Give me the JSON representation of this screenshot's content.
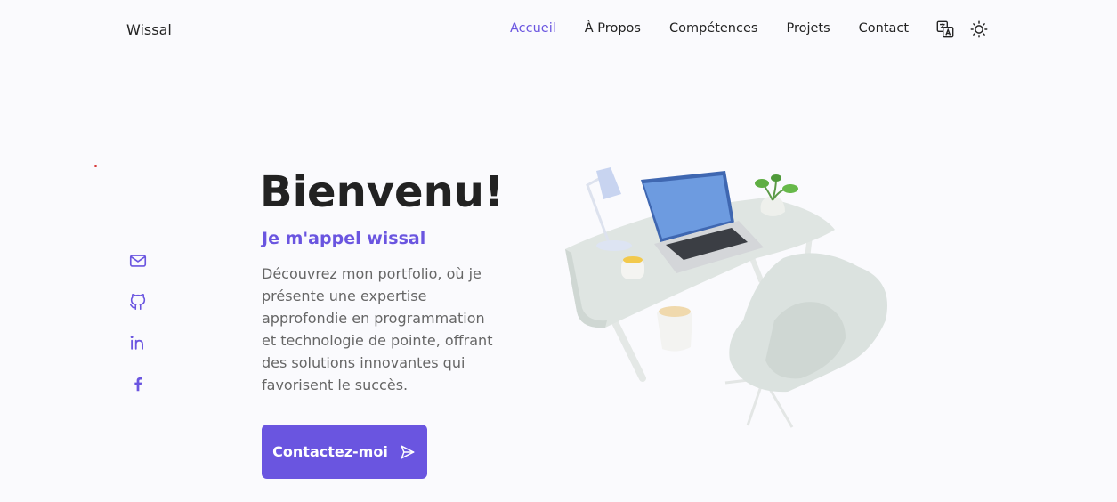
{
  "brand": "Wissal",
  "nav": {
    "items": [
      "Accueil",
      "À Propos",
      "Compétences",
      "Projets",
      "Contact"
    ],
    "active_index": 0,
    "translate_icon": "translate-icon",
    "theme_icon": "sun-icon"
  },
  "social": [
    "mail-icon",
    "github-icon",
    "linkedin-icon",
    "facebook-icon"
  ],
  "hero": {
    "title": "Bienvenu!",
    "subtitle": "Je m'appel wissal",
    "description": "Découvrez mon portfolio, où je présente une expertise approfondie en programmation et technologie de pointe, offrant des solutions innovantes qui favorisent le succès.",
    "cta_label": "Contactez-moi",
    "cta_icon": "send-icon"
  },
  "illustration": {
    "subject": "desk-workspace-illustration"
  },
  "colors": {
    "accent": "#6a55e0",
    "background": "#fafafd",
    "text": "#222222",
    "muted": "#666666"
  }
}
